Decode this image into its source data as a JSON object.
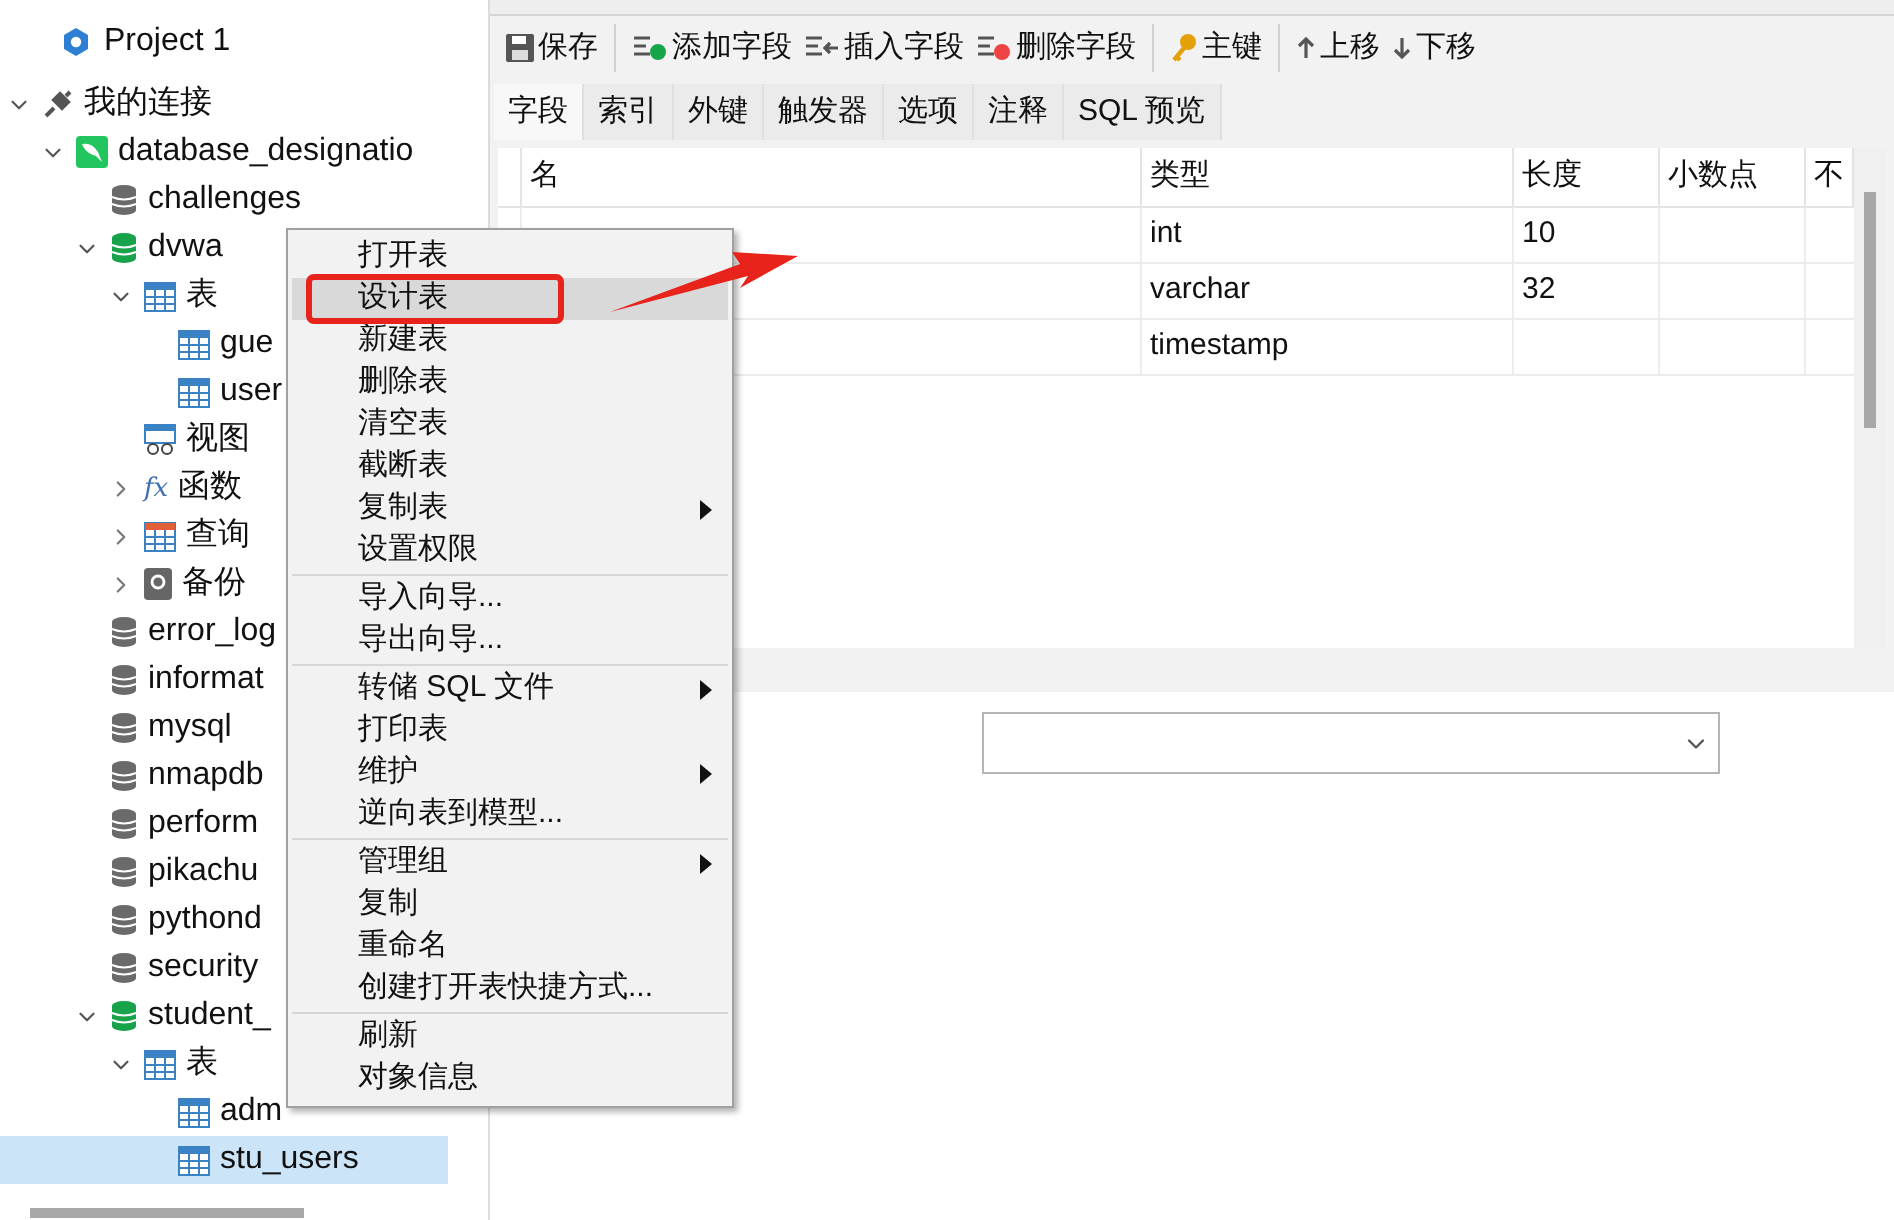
{
  "project": {
    "title": "Project 1"
  },
  "tree": [
    {
      "label": "我的连接",
      "kind": "connection",
      "expanded": true,
      "selected": false,
      "children": [
        {
          "label": "database_designatio",
          "kind": "server",
          "expanded": true,
          "selected": false,
          "children": [
            {
              "label": "challenges",
              "kind": "db",
              "selected": false
            },
            {
              "label": "dvwa",
              "kind": "db-open",
              "expanded": true,
              "selected": false,
              "children": [
                {
                  "label": "表",
                  "kind": "tables",
                  "expanded": true,
                  "selected": false,
                  "children": [
                    {
                      "label": "gue",
                      "kind": "table",
                      "selected": false
                    },
                    {
                      "label": "user",
                      "kind": "table",
                      "selected": false
                    }
                  ]
                },
                {
                  "label": "视图",
                  "kind": "views",
                  "selected": false
                },
                {
                  "label": "函数",
                  "kind": "functions",
                  "icon": "fx",
                  "expanded": false,
                  "selected": false
                },
                {
                  "label": "查询",
                  "kind": "queries",
                  "expanded": false,
                  "selected": false
                },
                {
                  "label": "备份",
                  "kind": "backups",
                  "expanded": false,
                  "selected": false
                }
              ]
            },
            {
              "label": "error_log",
              "kind": "db",
              "selected": false
            },
            {
              "label": "informat",
              "kind": "db",
              "selected": false
            },
            {
              "label": "mysql",
              "kind": "db",
              "selected": false
            },
            {
              "label": "nmapdb",
              "kind": "db",
              "selected": false
            },
            {
              "label": "perform",
              "kind": "db",
              "selected": false
            },
            {
              "label": "pikachu",
              "kind": "db",
              "selected": false
            },
            {
              "label": "pythond",
              "kind": "db",
              "selected": false
            },
            {
              "label": "security",
              "kind": "db",
              "selected": false
            },
            {
              "label": "student_",
              "kind": "db-open",
              "expanded": true,
              "selected": false,
              "children": [
                {
                  "label": "表",
                  "kind": "tables",
                  "expanded": true,
                  "selected": false,
                  "children": [
                    {
                      "label": "adm",
                      "kind": "table",
                      "selected": false
                    },
                    {
                      "label": "stu_users",
                      "kind": "table",
                      "selected": true
                    }
                  ]
                }
              ]
            }
          ]
        }
      ]
    }
  ],
  "toolbar": [
    {
      "label": "保存",
      "kind": "save"
    },
    {
      "label": "添加字段",
      "kind": "add"
    },
    {
      "label": "插入字段",
      "kind": "insert"
    },
    {
      "label": "删除字段",
      "kind": "delete"
    },
    {
      "label": "主键",
      "kind": "key"
    },
    {
      "label": "上移",
      "kind": "up"
    },
    {
      "label": "下移",
      "kind": "down"
    }
  ],
  "tabs": [
    {
      "label": "字段",
      "selected": true
    },
    {
      "label": "索引",
      "selected": false
    },
    {
      "label": "外键",
      "selected": false
    },
    {
      "label": "触发器",
      "selected": false
    },
    {
      "label": "选项",
      "selected": false
    },
    {
      "label": "注释",
      "selected": false
    },
    {
      "label": "SQL 预览",
      "selected": false
    }
  ],
  "table": {
    "columns": [
      "名",
      "类型",
      "长度",
      "小数点",
      "不"
    ],
    "rows": [
      {
        "type": "int",
        "length": "10"
      },
      {
        "type": "varchar",
        "length": "32"
      },
      {
        "type": "timestamp",
        "length": ""
      }
    ]
  },
  "context_menu": [
    [
      {
        "label": "打开表",
        "submenu": false,
        "selected": false
      },
      {
        "label": "设计表",
        "submenu": false,
        "selected": true
      },
      {
        "label": "新建表",
        "submenu": false,
        "selected": false
      },
      {
        "label": "删除表",
        "submenu": false,
        "selected": false
      },
      {
        "label": "清空表",
        "submenu": false,
        "selected": false
      },
      {
        "label": "截断表",
        "submenu": false,
        "selected": false
      },
      {
        "label": "复制表",
        "submenu": true,
        "selected": false
      },
      {
        "label": "设置权限",
        "submenu": false,
        "selected": false
      }
    ],
    [
      {
        "label": "导入向导...",
        "submenu": false,
        "selected": false
      },
      {
        "label": "导出向导...",
        "submenu": false,
        "selected": false
      }
    ],
    [
      {
        "label": "转储 SQL 文件",
        "submenu": true,
        "selected": false
      },
      {
        "label": "打印表",
        "submenu": false,
        "selected": false
      },
      {
        "label": "维护",
        "submenu": true,
        "selected": false
      },
      {
        "label": "逆向表到模型...",
        "submenu": false,
        "selected": false
      }
    ],
    [
      {
        "label": "管理组",
        "submenu": true,
        "selected": false
      },
      {
        "label": "复制",
        "submenu": false,
        "selected": false
      },
      {
        "label": "重命名",
        "submenu": false,
        "selected": false
      },
      {
        "label": "创建打开表快捷方式...",
        "submenu": false,
        "selected": false
      }
    ],
    [
      {
        "label": "刷新",
        "submenu": false,
        "selected": false
      },
      {
        "label": "对象信息",
        "submenu": false,
        "selected": false
      }
    ]
  ]
}
